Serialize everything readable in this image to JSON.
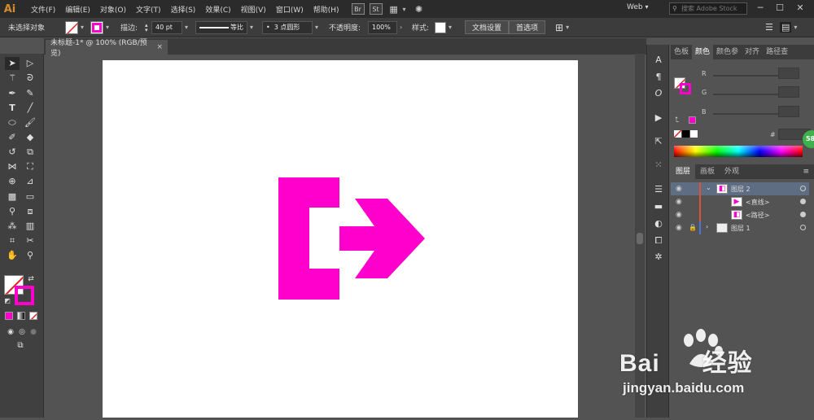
{
  "app": {
    "logo": "Ai",
    "brand_color": "#d58b2a"
  },
  "menubar": {
    "items": [
      "文件(F)",
      "编辑(E)",
      "对象(O)",
      "文字(T)",
      "选择(S)",
      "效果(C)",
      "视图(V)",
      "窗口(W)",
      "帮助(H)"
    ],
    "bridge_label": "Br",
    "stock_label": "St",
    "workspace": "Web",
    "search_placeholder": "搜索 Adobe Stock"
  },
  "controlbar": {
    "selection_status": "未选择对象",
    "stroke_label": "描边:",
    "stroke_weight": "40 pt",
    "profile_label": "等比",
    "brush_label": "3 点圆形",
    "opacity_label": "不透明度:",
    "opacity_value": "100%",
    "style_label": "样式:",
    "doc_setup_button": "文档设置",
    "preferences_button": "首选项",
    "fill_color": "#ff00cc"
  },
  "document": {
    "tab_title": "未标题-1* @ 100% (RGB/预览)",
    "close": "×"
  },
  "color_panel": {
    "tabs": [
      "色板",
      "颜色",
      "颜色参",
      "对齐",
      "路径查"
    ],
    "active_tab": "颜色",
    "channels": [
      "R",
      "G",
      "B"
    ],
    "hex_label": "#"
  },
  "layers_panel": {
    "tabs": [
      "图层",
      "画板",
      "外观"
    ],
    "active_tab": "图层",
    "rows": [
      {
        "name": "图层 2",
        "expanded": true
      },
      {
        "name": "<直线>"
      },
      {
        "name": "<路径>"
      },
      {
        "name": "图层 1",
        "locked": true
      }
    ]
  },
  "artwork": {
    "shape_color": "#ff00cc"
  },
  "notification": {
    "count": "58"
  },
  "watermark": {
    "brand": "Bai",
    "brand_suffix": "经验",
    "url": "jingyan.baidu.com"
  }
}
